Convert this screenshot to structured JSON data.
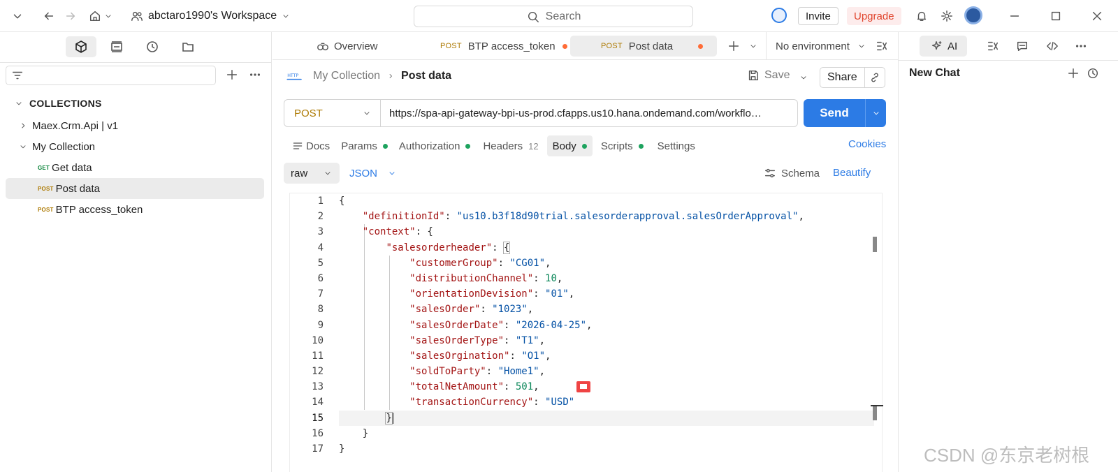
{
  "topbar": {
    "workspace": "abctaro1990's Workspace",
    "search_placeholder": "Search",
    "invite": "Invite",
    "upgrade": "Upgrade"
  },
  "sidebar": {
    "collections_title": "COLLECTIONS",
    "items": [
      {
        "label": "Maex.Crm.Api | v1",
        "kind": "folder",
        "expanded": false
      },
      {
        "label": "My Collection",
        "kind": "folder",
        "expanded": true
      },
      {
        "method": "GET",
        "label": "Get data",
        "kind": "request"
      },
      {
        "method": "POST",
        "label": "Post data",
        "kind": "request",
        "selected": true
      },
      {
        "method": "POST",
        "label": "BTP access_token",
        "kind": "request"
      }
    ]
  },
  "tabs": {
    "overview": "Overview",
    "items": [
      {
        "method": "POST",
        "label": "BTP access_token",
        "unsaved": true
      },
      {
        "method": "POST",
        "label": "Post data",
        "unsaved": true,
        "active": true
      }
    ],
    "environment": "No environment"
  },
  "request": {
    "collection": "My Collection",
    "name": "Post data",
    "save": "Save",
    "share": "Share",
    "method": "POST",
    "url": "https://spa-api-gateway-bpi-us-prod.cfapps.us10.hana.ondemand.com/workflo…",
    "send": "Send"
  },
  "subtabs": {
    "docs": "Docs",
    "params": "Params",
    "authorization": "Authorization",
    "headers": "Headers",
    "headers_count": "12",
    "body": "Body",
    "scripts": "Scripts",
    "settings": "Settings",
    "cookies": "Cookies"
  },
  "body_options": {
    "mode": "raw",
    "format": "JSON",
    "schema": "Schema",
    "beautify": "Beautify"
  },
  "editor": {
    "line_numbers": [
      "1",
      "2",
      "3",
      "4",
      "5",
      "6",
      "7",
      "8",
      "9",
      "10",
      "11",
      "12",
      "13",
      "14",
      "15",
      "16",
      "17"
    ],
    "code": {
      "definitionId_key": "\"definitionId\"",
      "definitionId_val": "\"us10.b3f18d90trial.salesorderapproval.salesOrderApproval\"",
      "context_key": "\"context\"",
      "header_key": "\"salesorderheader\"",
      "f1k": "\"customerGroup\"",
      "f1v": "\"CG01\"",
      "f2k": "\"distributionChannel\"",
      "f2v": "10",
      "f3k": "\"orientationDevision\"",
      "f3v": "\"01\"",
      "f4k": "\"salesOrder\"",
      "f4v": "\"1023\"",
      "f5k": "\"salesOrderDate\"",
      "f5v": "\"2026-04-25\"",
      "f6k": "\"salesOrderType\"",
      "f6v": "\"T1\"",
      "f7k": "\"salesOrgination\"",
      "f7v": "\"O1\"",
      "f8k": "\"soldToParty\"",
      "f8v": "\"Home1\"",
      "f9k": "\"totalNetAmount\"",
      "f9v": "501",
      "f10k": "\"transactionCurrency\"",
      "f10v": "\"USD\""
    }
  },
  "rightpanel": {
    "ai": "AI",
    "new_chat": "New Chat"
  },
  "watermark": "CSDN @东京老树根",
  "colors": {
    "accent": "#2c7be5",
    "post": "#ad7a03",
    "get": "#007f31",
    "unsaved": "#ff6c37",
    "upgrade": "#e0432b"
  }
}
